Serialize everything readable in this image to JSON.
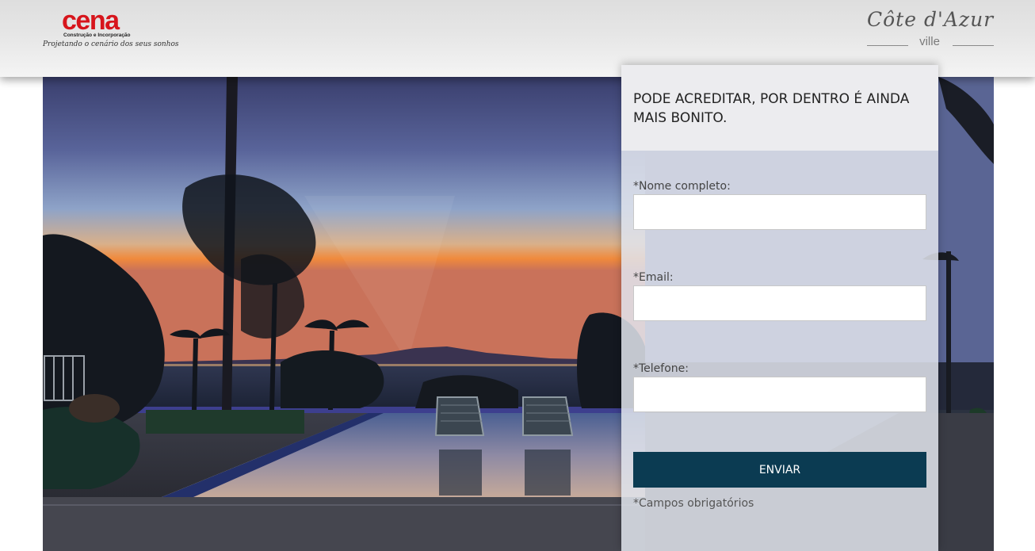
{
  "header": {
    "brand_name": "cena",
    "brand_subtitle": "Construção e Incorporação",
    "brand_tagline": "Projetando o cenário dos seus sonhos",
    "project_name": "Côte d'Azur",
    "project_subname": "ville"
  },
  "form": {
    "title": "PODE ACREDITAR, POR DENTRO É AINDA MAIS BONITO.",
    "name_label": "*Nome completo:",
    "name_value": "",
    "email_label": "*Email:",
    "email_value": "",
    "phone_label": "*Telefone:",
    "phone_value": "",
    "submit_label": "ENVIAR",
    "required_note": "*Campos obrigatórios"
  },
  "colors": {
    "brand_red": "#d7151c",
    "button_navy": "#0b3b52"
  }
}
